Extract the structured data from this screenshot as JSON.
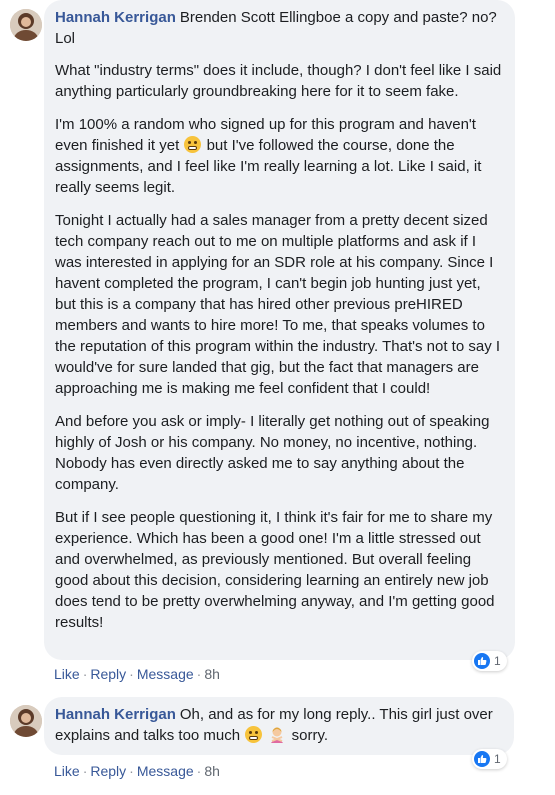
{
  "comments": [
    {
      "author": "Hannah Kerrigan",
      "paragraphs": [
        "Brenden Scott Ellingboe a copy and paste? no? Lol",
        "What \"industry terms\" does it include, though? I don't feel like I said anything particularly groundbreaking here for it to seem fake.",
        "I'm 100% a random who signed up for this program and haven't even finished it yet",
        "but I've followed the course, done the assignments, and I feel like I'm really learning a lot. Like I said, it really seems legit.",
        "Tonight I actually had a sales manager from a pretty decent sized tech company reach out to me on multiple platforms and ask if I was interested in applying for an SDR role at his company. Since I havent completed the program, I can't begin job hunting just yet, but this is a company that has hired other previous preHIRED members and wants to hire more! To me, that speaks volumes to the reputation of this program within the industry. That's not to say I would've for sure landed that gig, but the fact that managers are approaching me is making me feel confident that I could!",
        "And before you ask or imply- I literally get nothing out of speaking highly of Josh or his company. No money, no incentive, nothing. Nobody has even directly asked me to say anything about the company.",
        "But if I see people questioning it, I think it's fair for me to share my experience. Which has been a good one! I'm a little stressed out and overwhelmed, as previously mentioned. But overall feeling good about this decision, considering learning an entirely new job does tend to be pretty overwhelming anyway, and I'm getting good results!"
      ],
      "actions": {
        "like": "Like",
        "reply": "Reply",
        "message": "Message",
        "time": "8h",
        "sep": "·"
      },
      "reaction_count": "1"
    },
    {
      "author": "Hannah Kerrigan",
      "text_before": "Oh, and as for my long reply.. This girl just over explains and talks too much",
      "text_after": "sorry.",
      "actions": {
        "like": "Like",
        "reply": "Reply",
        "message": "Message",
        "time": "8h",
        "sep": "·"
      },
      "reaction_count": "1"
    }
  ],
  "icons": {
    "grimace": "grimacing-face-emoji",
    "person": "person-gesturing-no-emoji",
    "like": "thumbs-up-icon"
  },
  "colors": {
    "name": "#385898",
    "bubble": "#f0f2f5",
    "like": "#1877f2"
  }
}
